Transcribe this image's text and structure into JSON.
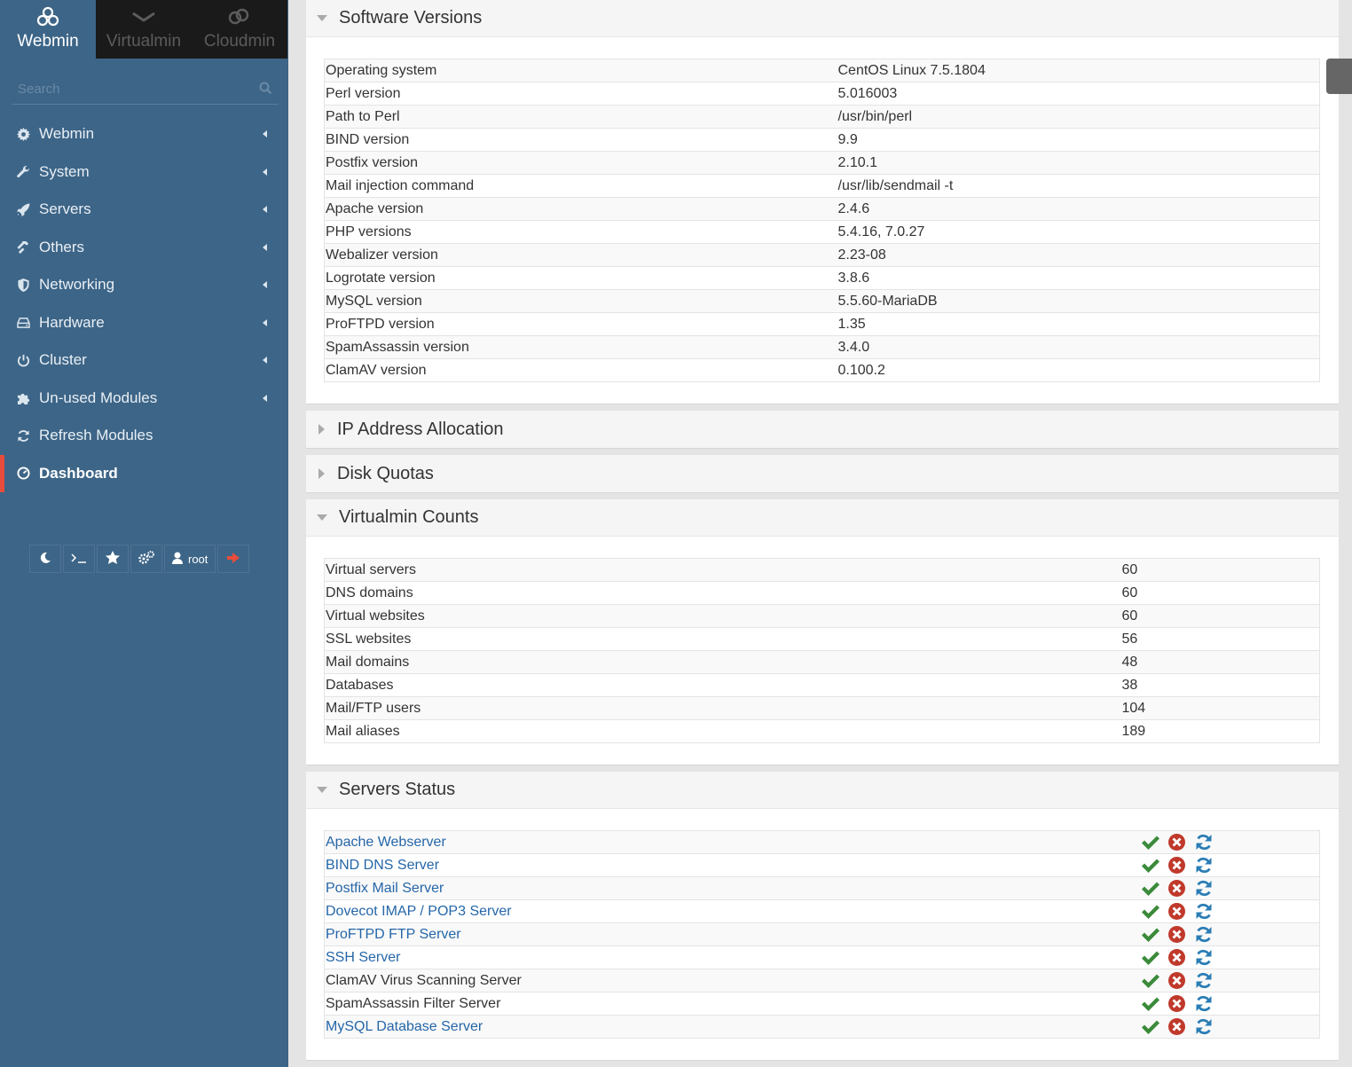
{
  "top_tabs": [
    {
      "label": "Webmin",
      "icon": "webmin-logo-icon",
      "active": true
    },
    {
      "label": "Virtualmin",
      "icon": "virtualmin-logo-icon",
      "active": false
    },
    {
      "label": "Cloudmin",
      "icon": "cloudmin-logo-icon",
      "active": false
    }
  ],
  "search": {
    "placeholder": "Search"
  },
  "nav": [
    {
      "label": "Webmin",
      "icon": "gear-icon"
    },
    {
      "label": "System",
      "icon": "wrench-icon"
    },
    {
      "label": "Servers",
      "icon": "rocket-icon"
    },
    {
      "label": "Others",
      "icon": "hammer-icon"
    },
    {
      "label": "Networking",
      "icon": "shield-icon"
    },
    {
      "label": "Hardware",
      "icon": "hdd-icon"
    },
    {
      "label": "Cluster",
      "icon": "power-icon"
    },
    {
      "label": "Un-used Modules",
      "icon": "puzzle-icon"
    },
    {
      "label": "Refresh Modules",
      "icon": "refresh-icon"
    },
    {
      "label": "Dashboard",
      "icon": "dashboard-icon",
      "active": true
    }
  ],
  "toolbar": {
    "user_label": "root"
  },
  "panels": {
    "software": {
      "title": "Software Versions",
      "rows": [
        [
          "Operating system",
          "CentOS Linux 7.5.1804"
        ],
        [
          "Perl version",
          "5.016003"
        ],
        [
          "Path to Perl",
          "/usr/bin/perl"
        ],
        [
          "BIND version",
          "9.9"
        ],
        [
          "Postfix version",
          "2.10.1"
        ],
        [
          "Mail injection command",
          "/usr/lib/sendmail -t"
        ],
        [
          "Apache version",
          "2.4.6"
        ],
        [
          "PHP versions",
          "5.4.16, 7.0.27"
        ],
        [
          "Webalizer version",
          "2.23-08"
        ],
        [
          "Logrotate version",
          "3.8.6"
        ],
        [
          "MySQL version",
          "5.5.60-MariaDB"
        ],
        [
          "ProFTPD version",
          "1.35"
        ],
        [
          "SpamAssassin version",
          "3.4.0"
        ],
        [
          "ClamAV version",
          "0.100.2"
        ]
      ]
    },
    "ip": {
      "title": "IP Address Allocation"
    },
    "quotas": {
      "title": "Disk Quotas"
    },
    "counts": {
      "title": "Virtualmin Counts",
      "rows": [
        [
          "Virtual servers",
          "60"
        ],
        [
          "DNS domains",
          "60"
        ],
        [
          "Virtual websites",
          "60"
        ],
        [
          "SSL websites",
          "56"
        ],
        [
          "Mail domains",
          "48"
        ],
        [
          "Databases",
          "38"
        ],
        [
          "Mail/FTP users",
          "104"
        ],
        [
          "Mail aliases",
          "189"
        ]
      ]
    },
    "servers": {
      "title": "Servers Status",
      "rows": [
        {
          "name": "Apache Webserver",
          "link": true
        },
        {
          "name": "BIND DNS Server",
          "link": true
        },
        {
          "name": "Postfix Mail Server",
          "link": true
        },
        {
          "name": "Dovecot IMAP / POP3 Server",
          "link": true
        },
        {
          "name": "ProFTPD FTP Server",
          "link": true
        },
        {
          "name": "SSH Server",
          "link": true
        },
        {
          "name": "ClamAV Virus Scanning Server",
          "link": false
        },
        {
          "name": "SpamAssassin Filter Server",
          "link": false
        },
        {
          "name": "MySQL Database Server",
          "link": true
        }
      ]
    }
  },
  "colors": {
    "sidebar": "#3d6587",
    "accent": "#e74c3c",
    "link": "#2566a8",
    "ok": "#3a8a3a",
    "stop": "#c0392b",
    "restart": "#2a7db5"
  }
}
